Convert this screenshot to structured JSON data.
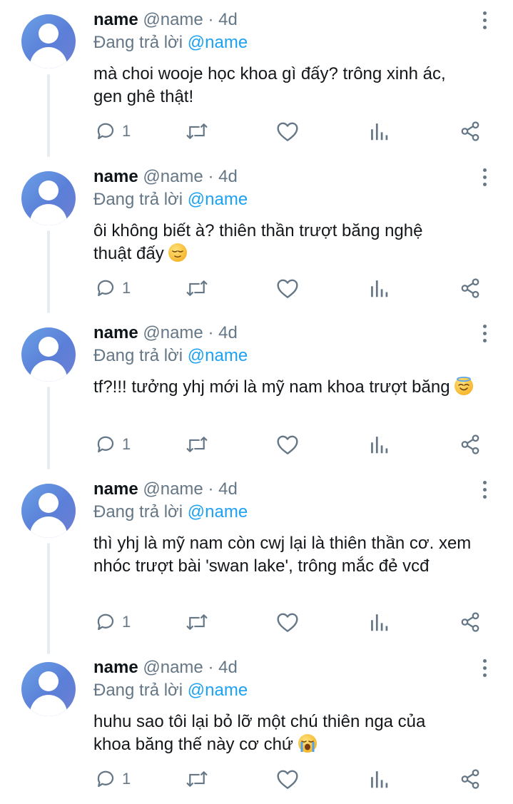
{
  "tweets": [
    {
      "name": "name",
      "handle": "@name",
      "dot": "·",
      "time": "4d",
      "reply_prefix": "Đang trả lời ",
      "reply_handle": "@name",
      "text": "mà choi wooje học khoa gì đấy? trông xinh ác, gen ghê thật!",
      "emoji": null,
      "reply_count": "1"
    },
    {
      "name": "name",
      "handle": "@name",
      "dot": "·",
      "time": "4d",
      "reply_prefix": "Đang trả lời ",
      "reply_handle": "@name",
      "text": "ôi không biết à? thiên thần trượt băng nghệ thuật đấy ",
      "emoji": "relieved-face",
      "reply_count": "1"
    },
    {
      "name": "name",
      "handle": "@name",
      "dot": "·",
      "time": "4d",
      "reply_prefix": "Đang trả lời ",
      "reply_handle": "@name",
      "text": "tf?!!! tưởng yhj mới là mỹ nam khoa trượt băng ",
      "emoji": "smiling-face-with-halo",
      "reply_count": "1"
    },
    {
      "name": "name",
      "handle": "@name",
      "dot": "·",
      "time": "4d",
      "reply_prefix": "Đang trả lời ",
      "reply_handle": "@name",
      "text": "thì yhj là mỹ nam còn cwj lại là thiên thần cơ. xem nhóc trượt bài 'swan lake', trông mắc đẻ vcđ",
      "emoji": null,
      "reply_count": "1"
    },
    {
      "name": "name",
      "handle": "@name",
      "dot": "·",
      "time": "4d",
      "reply_prefix": "Đang trả lời ",
      "reply_handle": "@name",
      "text": "huhu sao tôi lại bỏ lỡ một chú thiên nga của khoa băng thế này cơ chứ ",
      "emoji": "loudly-crying-face",
      "reply_count": "1"
    }
  ],
  "icons": {
    "reply": "reply-icon",
    "retweet": "retweet-icon",
    "like": "heart-icon",
    "analytics": "analytics-icon",
    "share": "share-icon",
    "more": "more-vertical-icon"
  },
  "colors": {
    "text": "#14171a",
    "secondary": "#657786",
    "link": "#1da1f2",
    "thread_line": "#e6ecf0",
    "avatar": "#5b7fd8"
  }
}
